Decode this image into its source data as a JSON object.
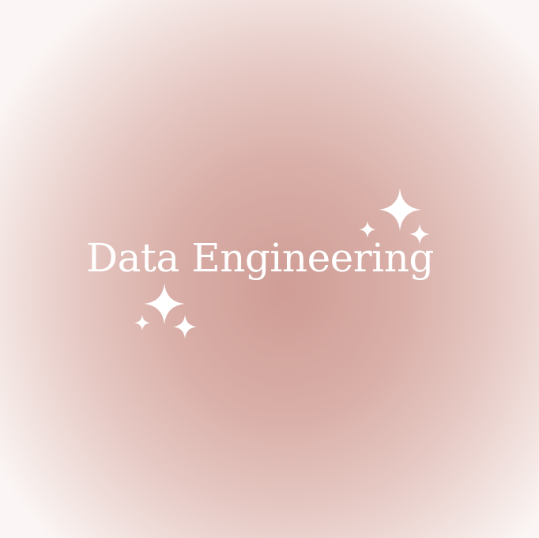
{
  "title": "Data Engineering",
  "colors": {
    "background_center": "#cf9d95",
    "background_edge": "#fbf6f5",
    "text": "#ffffff",
    "sparkle": "#ffffff"
  },
  "decorations": {
    "upper_sparkles": "sparkle-cluster-icon",
    "lower_sparkles": "sparkle-cluster-icon"
  }
}
